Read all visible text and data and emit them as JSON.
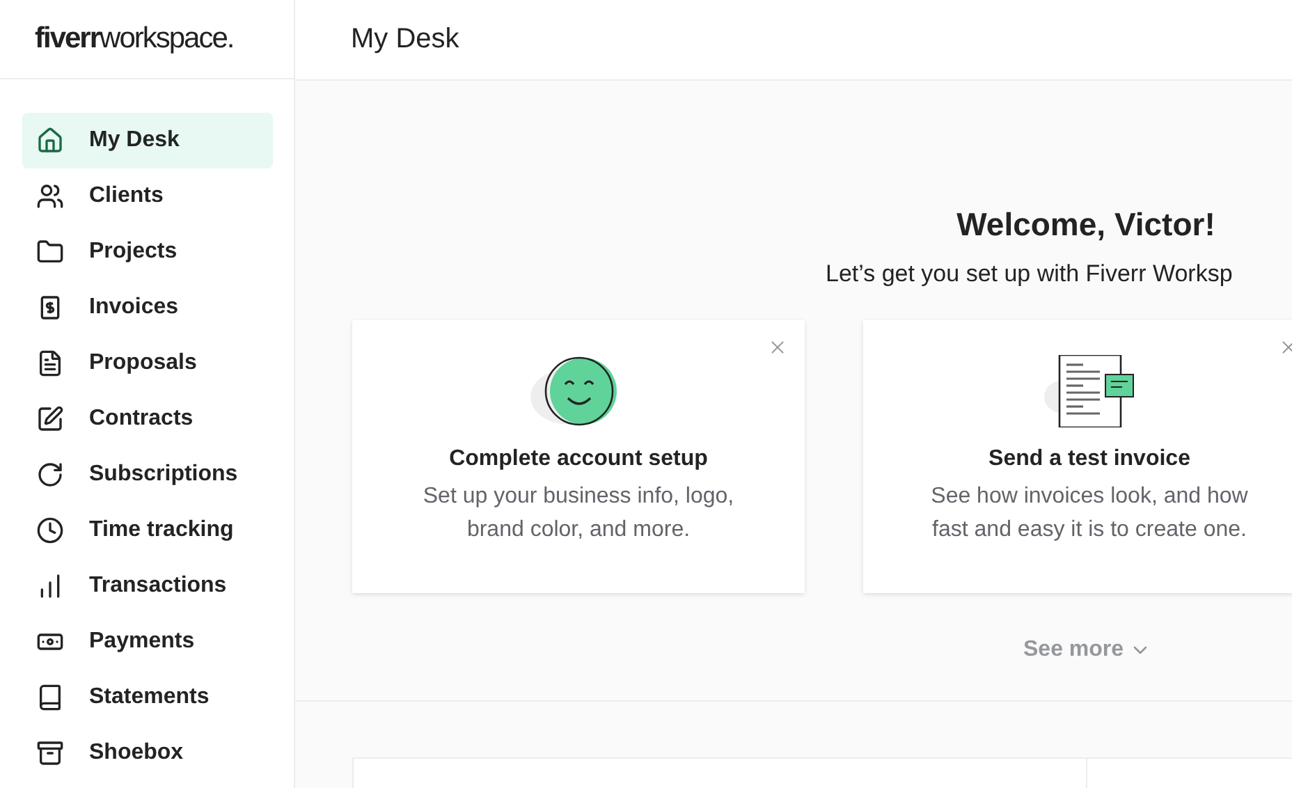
{
  "logo": {
    "text": "**fiverr**workspace."
  },
  "header": {
    "title": "My Desk"
  },
  "sidebar": {
    "items": [
      {
        "label": "My Desk",
        "selected": true
      },
      {
        "label": "Clients",
        "selected": false
      },
      {
        "label": "Projects",
        "selected": false
      },
      {
        "label": "Invoices",
        "selected": false
      },
      {
        "label": "Proposals",
        "selected": false
      },
      {
        "label": "Contracts",
        "selected": false
      },
      {
        "label": "Subscriptions",
        "selected": false
      },
      {
        "label": "Time tracking",
        "selected": false
      },
      {
        "label": "Transactions",
        "selected": false
      },
      {
        "label": "Payments",
        "selected": false
      },
      {
        "label": "Statements",
        "selected": false
      },
      {
        "label": "Shoebox",
        "selected": false
      }
    ]
  },
  "welcome": {
    "title": "Welcome, Victor!",
    "subtitle": "Let’s get you set up with Fiverr Worksp"
  },
  "cards": [
    {
      "kind": "smiley",
      "title": "Complete account setup",
      "text": "Set up your business info, logo, brand color, and more."
    },
    {
      "kind": "invoice",
      "title": "Send a test invoice",
      "text": "See how invoices look, and how fast and easy it is to create one."
    }
  ],
  "see_more": {
    "label": "See more"
  }
}
